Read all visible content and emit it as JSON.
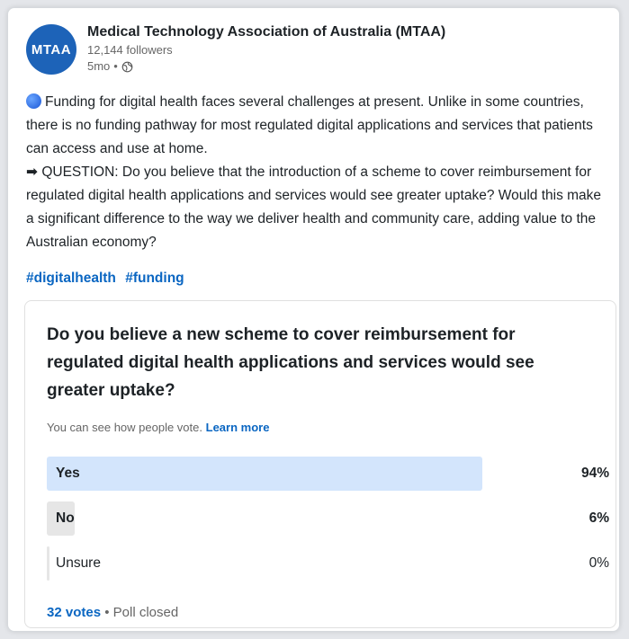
{
  "post": {
    "author": "Medical Technology Association of Australia (MTAA)",
    "logo_text": "MTAA",
    "followers": "12,144 followers",
    "time": "5mo",
    "separator": "•",
    "body_line1": "Funding for digital health faces several challenges at present. Unlike in some countries, there is no funding pathway for most regulated digital applications and services that patients can access and use at home.",
    "arrow": "➡",
    "body_line2": "QUESTION: Do you believe that the introduction of a scheme to cover reimbursement for regulated digital health applications and services would see greater uptake? Would this make a significant difference to the way we deliver health and community care, adding value to the Australian economy?",
    "hashtags": [
      "#digitalhealth",
      "#funding"
    ]
  },
  "poll": {
    "question": "Do you believe a new scheme to cover reimbursement for regulated digital health applications and services would see greater uptake?",
    "note": "You can see how people vote.",
    "learn_more": "Learn more",
    "options": [
      {
        "label": "Yes",
        "percent": "94%",
        "share": 0.94
      },
      {
        "label": "No",
        "percent": "6%",
        "share": 0.06
      },
      {
        "label": "Unsure",
        "percent": "0%",
        "share": 0.0
      }
    ],
    "votes": "32 votes",
    "footer_sep": "•",
    "status": "Poll closed"
  },
  "colors": {
    "winner_fill": "#d3e5fc",
    "other_fill": "#e6e6e6",
    "link": "#0a66c2"
  }
}
